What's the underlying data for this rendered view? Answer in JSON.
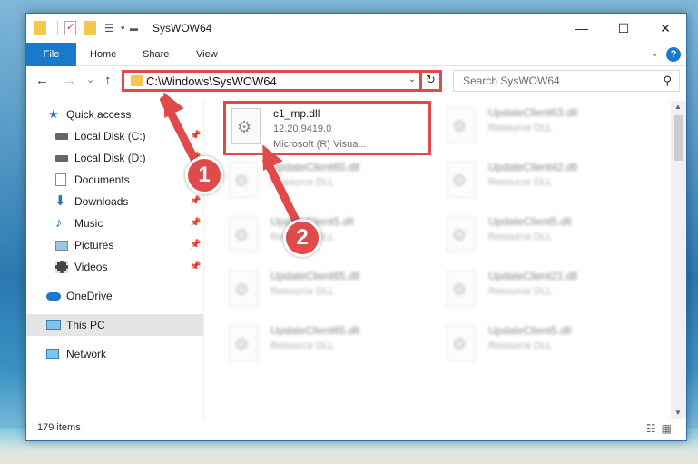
{
  "window": {
    "title": "SysWOW64",
    "controls": {
      "minimize": "—",
      "maximize": "☐",
      "close": "✕"
    }
  },
  "ribbon": {
    "tabs": [
      {
        "label": "File"
      },
      {
        "label": "Home"
      },
      {
        "label": "Share"
      },
      {
        "label": "View"
      }
    ],
    "help": "?"
  },
  "nav": {
    "back": "←",
    "forward": "→",
    "recent": "⌄",
    "up": "↑",
    "address": "C:\\Windows\\SysWOW64",
    "search_placeholder": "Search SysWOW64"
  },
  "sidebar": {
    "items": [
      {
        "label": "Quick access",
        "icon": "star-icon",
        "pinned": false
      },
      {
        "label": "Local Disk (C:)",
        "icon": "drive-icon",
        "pinned": true
      },
      {
        "label": "Local Disk (D:)",
        "icon": "drive-icon",
        "pinned": true
      },
      {
        "label": "Documents",
        "icon": "documents-icon",
        "pinned": true
      },
      {
        "label": "Downloads",
        "icon": "downloads-icon",
        "pinned": true
      },
      {
        "label": "Music",
        "icon": "music-icon",
        "pinned": true
      },
      {
        "label": "Pictures",
        "icon": "pictures-icon",
        "pinned": true
      },
      {
        "label": "Videos",
        "icon": "videos-icon",
        "pinned": true
      },
      {
        "label": "OneDrive",
        "icon": "onedrive-icon",
        "pinned": false
      },
      {
        "label": "This PC",
        "icon": "pc-icon",
        "pinned": false,
        "selected": true
      },
      {
        "label": "Network",
        "icon": "network-icon",
        "pinned": false
      }
    ]
  },
  "files": [
    {
      "name": "c1_mp.dll",
      "version": "12.20.9419.0",
      "desc": "Microsoft (R) Visua...",
      "highlighted": true
    },
    {
      "name": "UpdateClient63.dll",
      "desc": "Resource DLL"
    },
    {
      "name": "UpdateClient65.dll",
      "desc": "Resource DLL"
    },
    {
      "name": "UpdateClient42.dll",
      "desc": "Resource DLL"
    },
    {
      "name": "UpdateClient5.dll",
      "desc": "Resource DLL"
    },
    {
      "name": "UpdateClient5.dll",
      "desc": "Resource DLL"
    },
    {
      "name": "UpdateClient65.dll",
      "desc": "Resource DLL"
    },
    {
      "name": "UpdateClient21.dll",
      "desc": "Resource DLL"
    },
    {
      "name": "UpdateClient65.dll",
      "desc": "Resource DLL"
    },
    {
      "name": "UpdateClient5.dll",
      "desc": "Resource DLL"
    }
  ],
  "status": {
    "count": "179 items"
  },
  "annotations": {
    "step1": "1",
    "step2": "2"
  },
  "colors": {
    "accent": "#1979ca",
    "annotation": "#e04a4a"
  }
}
